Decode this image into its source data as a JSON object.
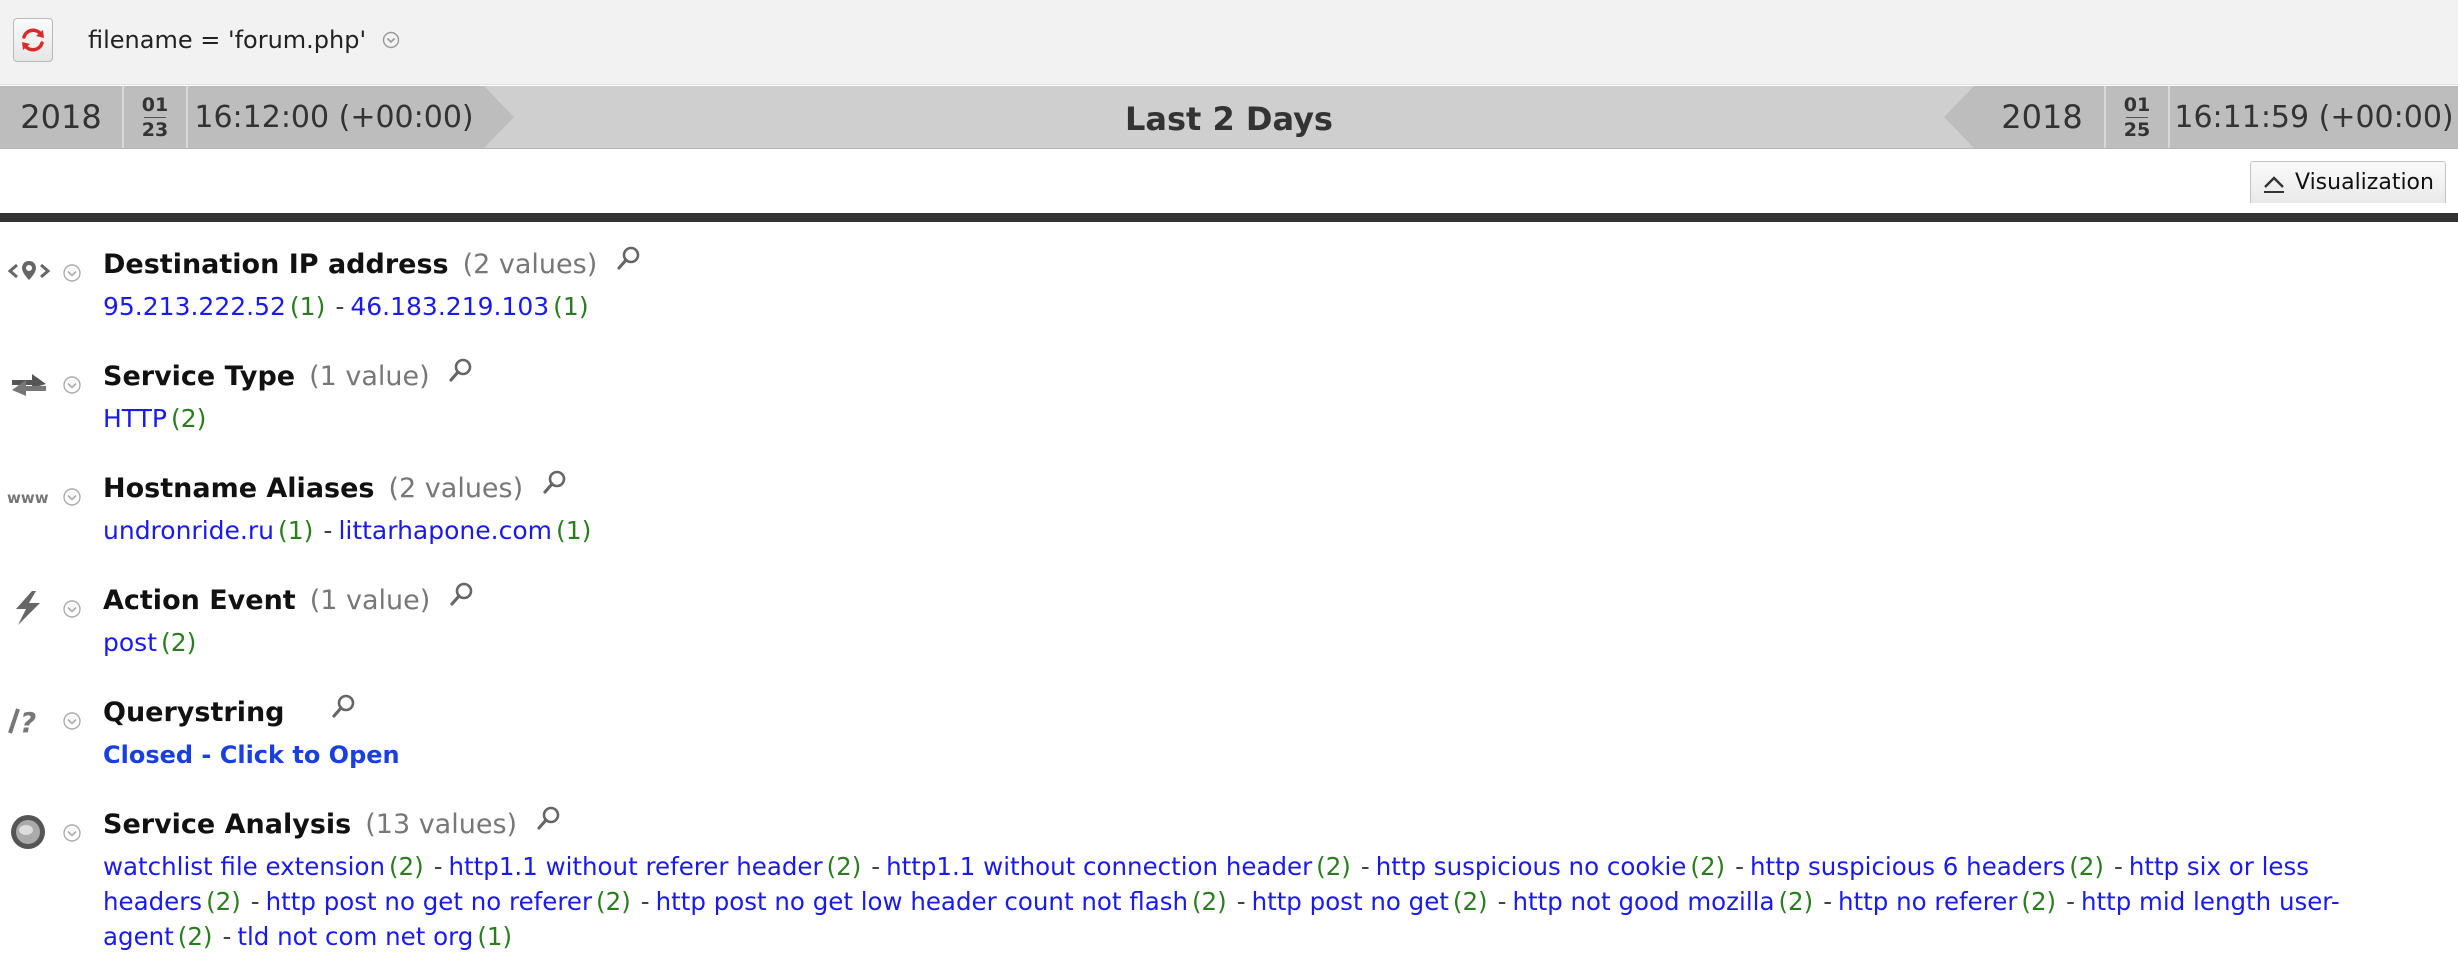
{
  "filter_bar": {
    "query": "filename = 'forum.php'"
  },
  "time_range": {
    "start": {
      "year": "2018",
      "month": "01",
      "day": "23",
      "time": "16:12:00 (+00:00)"
    },
    "label": "Last 2 Days",
    "end": {
      "year": "2018",
      "month": "01",
      "day": "25",
      "time": "16:11:59 (+00:00)"
    }
  },
  "visualization_button": "Visualization",
  "sections": [
    {
      "title": "Destination IP address",
      "count": "(2 values)",
      "values": [
        {
          "label": "95.213.222.52",
          "count": "(1)"
        },
        {
          "label": "46.183.219.103",
          "count": "(1)"
        }
      ]
    },
    {
      "title": "Service Type",
      "count": "(1 value)",
      "values": [
        {
          "label": "HTTP",
          "count": "(2)"
        }
      ]
    },
    {
      "title": "Hostname Aliases",
      "count": "(2 values)",
      "values": [
        {
          "label": "undronride.ru",
          "count": "(1)"
        },
        {
          "label": "littarhapone.com",
          "count": "(1)"
        }
      ]
    },
    {
      "title": "Action Event",
      "count": "(1 value)",
      "values": [
        {
          "label": "post",
          "count": "(2)"
        }
      ]
    },
    {
      "title": "Querystring",
      "count": "",
      "closed_text": "Closed - Click to Open"
    },
    {
      "title": "Service Analysis",
      "count": "(13 values)",
      "values": [
        {
          "label": "watchlist file extension",
          "count": "(2)"
        },
        {
          "label": "http1.1 without referer header",
          "count": "(2)"
        },
        {
          "label": "http1.1 without connection header",
          "count": "(2)"
        },
        {
          "label": "http suspicious no cookie",
          "count": "(2)"
        },
        {
          "label": "http suspicious 6 headers",
          "count": "(2)"
        },
        {
          "label": "http six or less headers",
          "count": "(2)"
        },
        {
          "label": "http post no get no referer",
          "count": "(2)"
        },
        {
          "label": "http post no get low header count not flash",
          "count": "(2)"
        },
        {
          "label": "http post no get",
          "count": "(2)"
        },
        {
          "label": "http not good mozilla",
          "count": "(2)"
        },
        {
          "label": "http no referer",
          "count": "(2)"
        },
        {
          "label": "http mid length user-agent",
          "count": "(2)"
        },
        {
          "label": "tld not com net org",
          "count": "(1)"
        }
      ]
    }
  ],
  "icons": {
    "refresh": "refresh-icon",
    "destination_ip": "destination-pin-icon",
    "service_type": "exchange-arrows-icon",
    "hostname": "www-icon",
    "action_event": "lightning-icon",
    "querystring": "query-question-icon",
    "service_analysis": "analysis-disc-icon",
    "search": "magnifier-icon",
    "expand": "chevron-down-icon",
    "collapse": "chevron-up-icon"
  },
  "colors": {
    "link": "#1a1aee",
    "count": "#2a7d1e",
    "refresh_red": "#d62b2b",
    "time_bar": "#cfcfcf"
  }
}
